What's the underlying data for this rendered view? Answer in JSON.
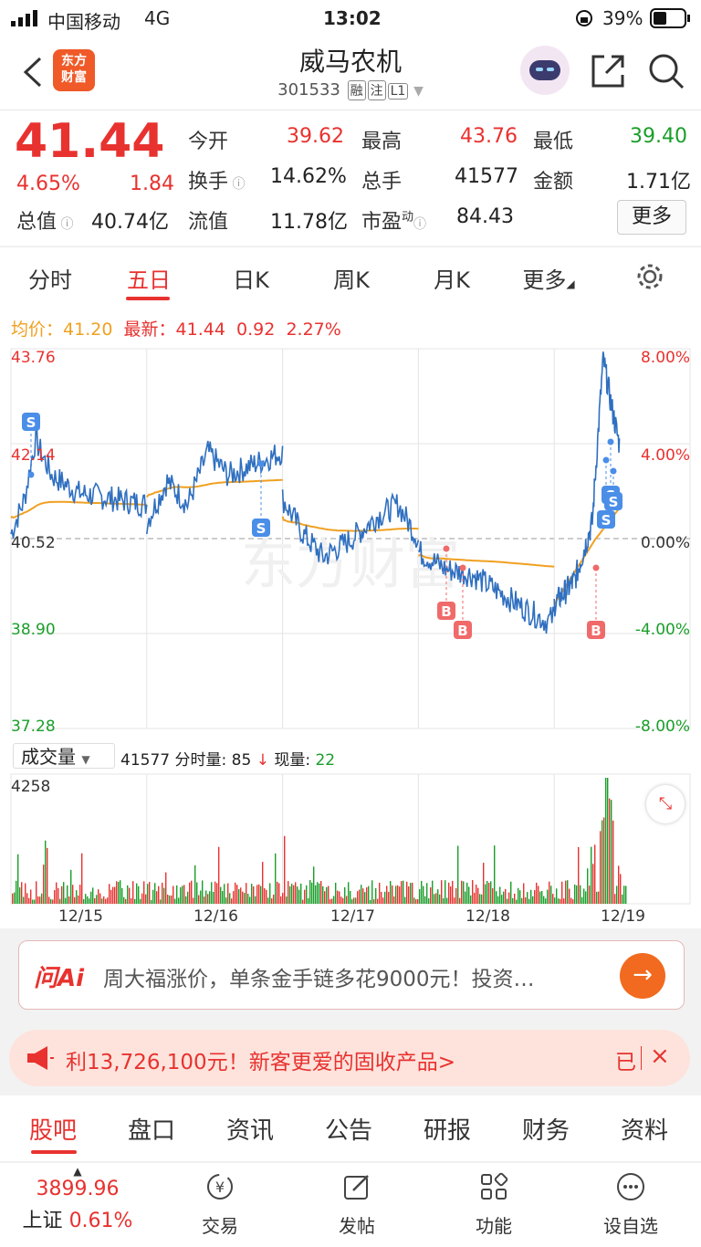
{
  "status_bar": {
    "carrier": "中国移动",
    "network": "4G",
    "time": "13:02",
    "battery": "39%"
  },
  "header": {
    "logo_line1": "东方",
    "logo_line2": "财富",
    "stock_name": "威马农机",
    "stock_code": "301533",
    "tags": [
      "融",
      "注",
      "L1"
    ]
  },
  "quote": {
    "price": "41.44",
    "change_pct": "4.65%",
    "change": "1.84",
    "open_label": "今开",
    "open": "39.62",
    "high_label": "最高",
    "high": "43.76",
    "low_label": "最低",
    "low": "39.40",
    "turnover_label": "换手",
    "turnover": "14.62%",
    "volume_label": "总手",
    "volume": "41577",
    "amount_label": "金额",
    "amount": "1.71亿",
    "mktcap_label": "总值",
    "mktcap": "40.74亿",
    "float_label": "流值",
    "float": "11.78亿",
    "pe_label": "市盈",
    "pe_sup": "动",
    "pe": "84.43",
    "more": "更多"
  },
  "tabs": [
    "分时",
    "五日",
    "日K",
    "周K",
    "月K",
    "更多"
  ],
  "active_tab": "五日",
  "chart_info": {
    "avg_label": "均价：",
    "avg": "41.20",
    "latest_label": "最新：",
    "latest": "41.44",
    "latest_chg": "0.92",
    "latest_pct": "2.27%"
  },
  "chart_data": {
    "type": "line",
    "left_ticks": [
      "43.76",
      "42.14",
      "40.52",
      "38.90",
      "37.28"
    ],
    "right_ticks": [
      "8.00%",
      "4.00%",
      "0.00%",
      "-4.00%",
      "-8.00%"
    ],
    "ylim": [
      37.28,
      43.76
    ],
    "baseline": 40.52,
    "days": [
      "12/15",
      "12/16",
      "12/17",
      "12/18",
      "12/19"
    ],
    "markers": [
      "S",
      "S",
      "S",
      "S",
      "S",
      "B",
      "B",
      "B"
    ],
    "series": [
      {
        "name": "price",
        "color": "#2f6fc0"
      },
      {
        "name": "avg",
        "color": "#f0a020"
      }
    ]
  },
  "volume": {
    "selector": "成交量",
    "total": "41577",
    "tick_label": "分时量:",
    "tick_value": "85",
    "now_label": "现量:",
    "now_value": "22",
    "max": "4258"
  },
  "ai_bar": {
    "logo": "问Ai",
    "text": "周大福涨价，单条金手链多花9000元！投资…",
    "button": "→"
  },
  "promo": {
    "text": "利13,726,100元！新客更爱的固收产品>",
    "right": "已",
    "close": "×"
  },
  "bottom_tabs": [
    "股吧",
    "盘口",
    "资讯",
    "公告",
    "研报",
    "财务",
    "资料"
  ],
  "bottom_nav": {
    "index_value": "3899.96",
    "index_name": "上证",
    "index_pct": "0.61%",
    "items": [
      "交易",
      "发帖",
      "功能",
      "设自选"
    ]
  }
}
